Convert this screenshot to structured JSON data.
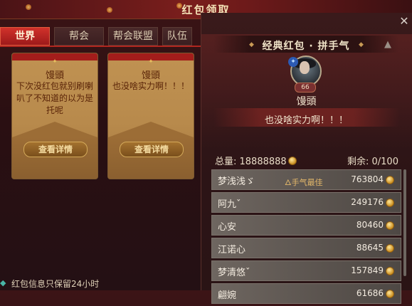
{
  "window": {
    "title": "红包领取"
  },
  "tabs": [
    {
      "label": "世界",
      "active": true
    },
    {
      "label": "帮会",
      "active": false
    },
    {
      "label": "帮会联盟",
      "active": false
    },
    {
      "label": "队伍",
      "active": false
    }
  ],
  "cards": [
    {
      "sender": "馒頭",
      "message": "下次没红包就别刷喇叭了不知道的以为是托呢",
      "button": "查看详情"
    },
    {
      "sender": "馒頭",
      "message": "也没啥实力啊！！！",
      "button": "查看详情"
    }
  ],
  "notice": "红包信息只保留24小时",
  "detail": {
    "subtitle": "经典红包 · 拼手气",
    "sender": "馒頭",
    "level": "66",
    "message": "也没啥实力啊！！！",
    "total_label": "总量: 18888888",
    "remaining_label": "剩余: 0/100",
    "best_label": "手气最佳",
    "recipients": [
      {
        "name": "梦浅浅ゞ",
        "amount": "763804",
        "best": true
      },
      {
        "name": "阿九ˇ",
        "amount": "249176",
        "best": false
      },
      {
        "name": "心安",
        "amount": "80460",
        "best": false
      },
      {
        "name": "江诺心",
        "amount": "88645",
        "best": false
      },
      {
        "name": "梦清悠ˇ",
        "amount": "157849",
        "best": false
      },
      {
        "name": "翩婉",
        "amount": "61686",
        "best": false
      }
    ]
  },
  "colors": {
    "accent": "#b0261f",
    "gold": "#c98d1f",
    "panel": "#2c1416"
  }
}
